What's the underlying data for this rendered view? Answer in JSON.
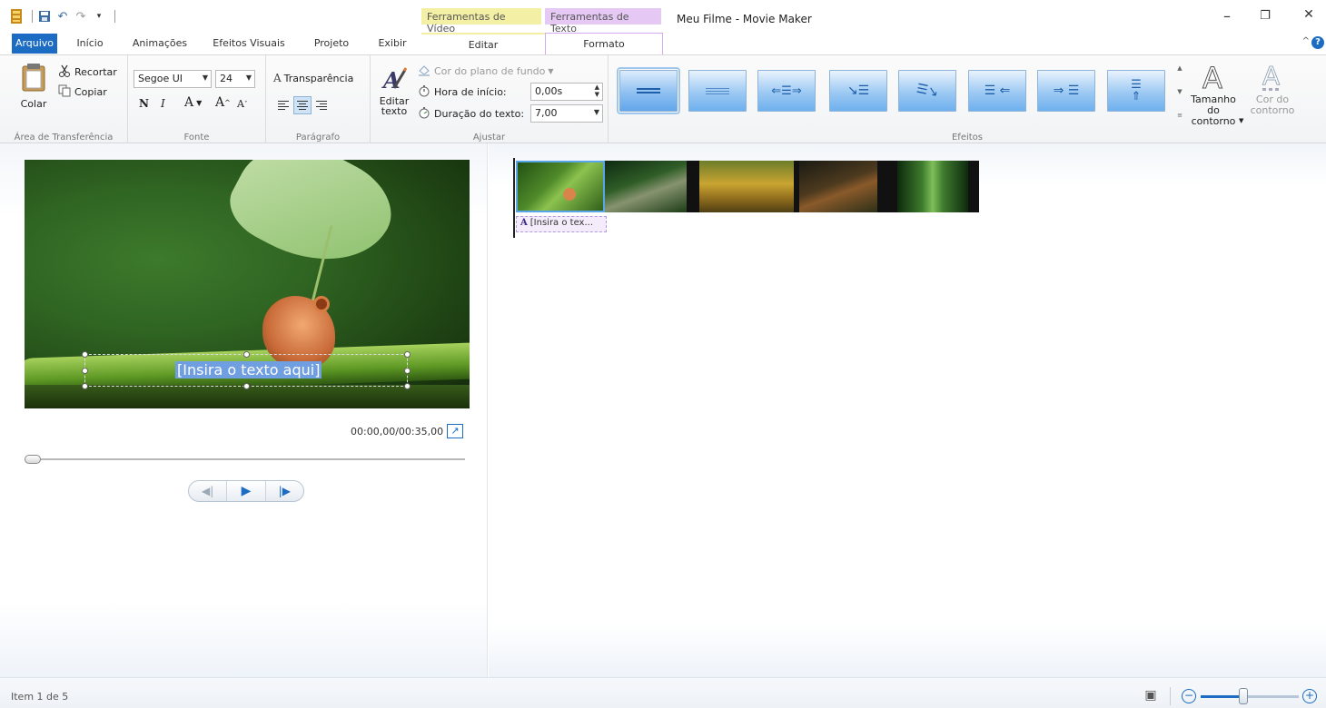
{
  "window": {
    "title": "Meu Filme - Movie Maker",
    "minimize": "–",
    "restore": "❐",
    "close": "✕"
  },
  "context_groups": {
    "video_tools": "Ferramentas de Vídeo",
    "text_tools": "Ferramentas de Texto"
  },
  "tabs": {
    "arquivo": "Arquivo",
    "inicio": "Início",
    "animacoes": "Animações",
    "efeitos_visuais": "Efeitos Visuais",
    "projeto": "Projeto",
    "exibir": "Exibir",
    "editar": "Editar",
    "formato": "Formato"
  },
  "ribbon": {
    "clipboard": {
      "label": "Área de Transferência",
      "paste": "Colar",
      "cut": "Recortar",
      "copy": "Copiar"
    },
    "font": {
      "label": "Fonte",
      "family": "Segoe UI",
      "size": "24",
      "bold": "N",
      "italic": "I",
      "font_color": "A",
      "grow": "A",
      "shrink": "A"
    },
    "paragraph": {
      "label": "Parágrafo",
      "transparency": "Transparência"
    },
    "adjust": {
      "label": "Ajustar",
      "edit_text": "Editar texto",
      "background_color": "Cor do plano de fundo",
      "start_time_label": "Hora de início:",
      "start_time_value": "0,00s",
      "duration_label": "Duração do texto:",
      "duration_value": "7,00"
    },
    "effects": {
      "label": "Efeitos",
      "outline_size": "Tamanho do contorno",
      "outline_color": "Cor do contorno"
    }
  },
  "preview": {
    "overlay_text": "[Insira o texto aqui]",
    "timecode": "00:00,00/00:35,00"
  },
  "storyboard": {
    "caption_label": "[Insira o tex..."
  },
  "status": {
    "item": "Item 1 de 5"
  }
}
